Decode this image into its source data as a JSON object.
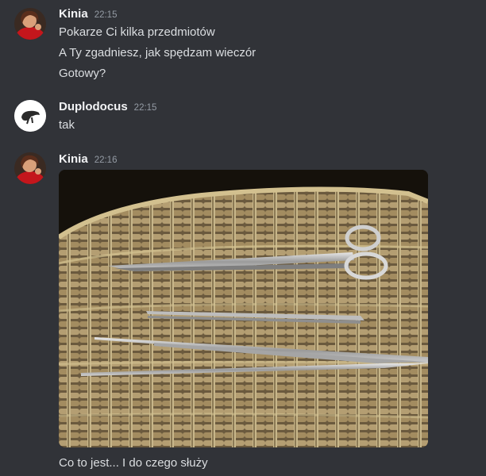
{
  "messages": [
    {
      "author": "Kinia",
      "time": "22:15",
      "lines": [
        "Pokarze Ci kilka przedmiotów",
        "A Ty zgadniesz, jak spędzam wieczór",
        "Gotowy?"
      ]
    },
    {
      "author": "Duplodocus",
      "time": "22:15",
      "lines": [
        "tak"
      ]
    },
    {
      "author": "Kinia",
      "time": "22:16",
      "attachment": "photo of surgical scissors and long tweezers on a wicker tray",
      "lines": [
        "Co to jest... I do czego służy"
      ]
    }
  ],
  "colors": {
    "background": "#313338",
    "username": "#f2f3f5",
    "text": "#dbdee1",
    "timestamp": "#949ba4"
  }
}
